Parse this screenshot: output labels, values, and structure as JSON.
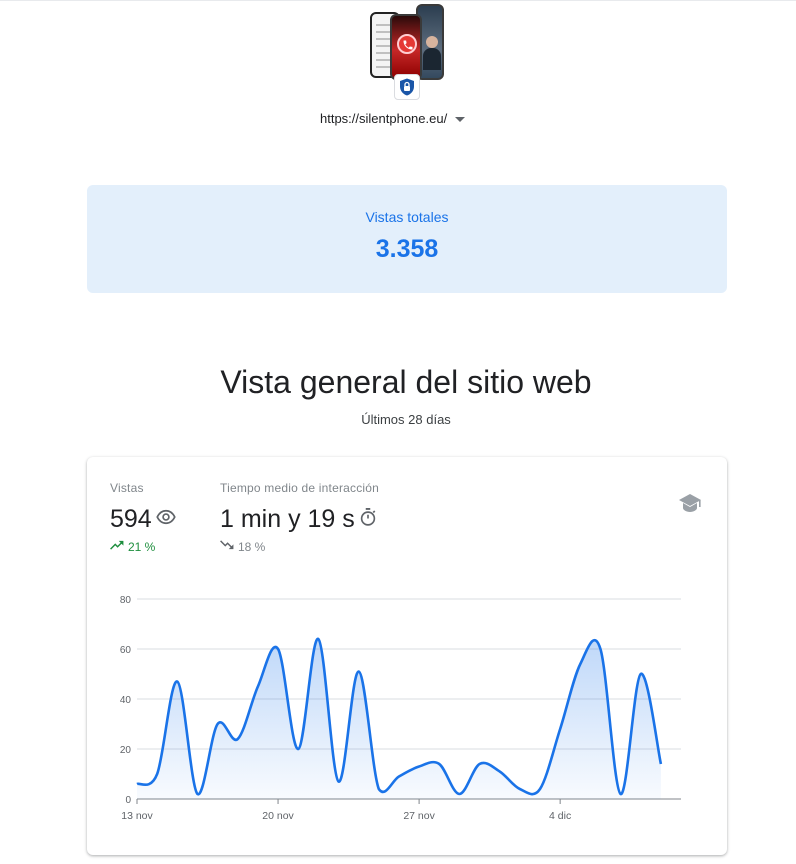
{
  "site": {
    "url": "https://silentphone.eu/",
    "thumbnail_icon": "phone-screens-thumbnail",
    "badge_icon": "lock-shield-icon"
  },
  "total_views": {
    "label": "Vistas totales",
    "value": "3.358"
  },
  "overview": {
    "title": "Vista general del sitio web",
    "subtitle": "Últimos 28 días",
    "metrics": [
      {
        "label": "Vistas",
        "value": "594",
        "icon": "eye-icon",
        "change": "21 %",
        "trend": "up",
        "trend_color": "#1e8e3e"
      },
      {
        "label": "Tiempo medio de interacción",
        "value": "1 min y 19 s",
        "icon": "timer-icon",
        "change": "18 %",
        "trend": "down",
        "trend_color": "#80868b"
      }
    ],
    "learn_icon": "school-icon"
  },
  "colors": {
    "accent": "#1a73e8",
    "card_bg": "#e3effb",
    "line": "#1a73e8"
  },
  "chart_data": {
    "type": "area",
    "title": "",
    "xlabel": "",
    "ylabel": "",
    "ylim": [
      0,
      80
    ],
    "yticks": [
      0,
      20,
      40,
      60,
      80
    ],
    "x": [
      "13 nov",
      "14 nov",
      "15 nov",
      "16 nov",
      "17 nov",
      "18 nov",
      "19 nov",
      "20 nov",
      "21 nov",
      "22 nov",
      "23 nov",
      "24 nov",
      "25 nov",
      "26 nov",
      "27 nov",
      "28 nov",
      "29 nov",
      "30 nov",
      "1 dic",
      "2 dic",
      "3 dic",
      "4 dic",
      "5 dic",
      "6 dic",
      "7 dic",
      "8 dic",
      "9 dic",
      "10 dic"
    ],
    "xtick_labels": [
      "13 nov",
      "20 nov",
      "27 nov",
      "4 dic"
    ],
    "series": [
      {
        "values": [
          6,
          10,
          47,
          2,
          30,
          24,
          45,
          60,
          20,
          64,
          7,
          51,
          4,
          9,
          13,
          14,
          2,
          14,
          11,
          4,
          4,
          28,
          54,
          60,
          2,
          50,
          14
        ]
      }
    ],
    "grid": true
  }
}
